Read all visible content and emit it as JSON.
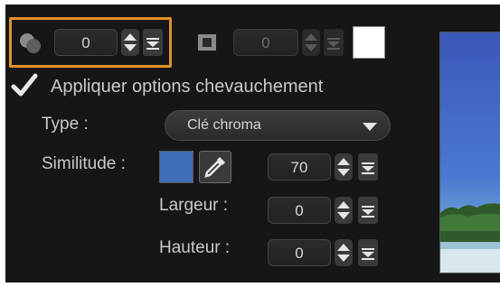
{
  "overlay_toolbar": {
    "primary_value": "0",
    "secondary_value": "0"
  },
  "overlap": {
    "checkbox_label": "Appliquer options chevauchement",
    "checked": true
  },
  "type": {
    "label": "Type :",
    "selected": "Clé chroma"
  },
  "similitude": {
    "label": "Similitude :",
    "swatch_color": "#3e6eb6",
    "value": "70"
  },
  "largeur": {
    "label": "Largeur :",
    "value": "0"
  },
  "hauteur": {
    "label": "Hauteur :",
    "value": "0"
  },
  "colors": {
    "accent": "#e0902a",
    "panel_bg": "#161616"
  }
}
